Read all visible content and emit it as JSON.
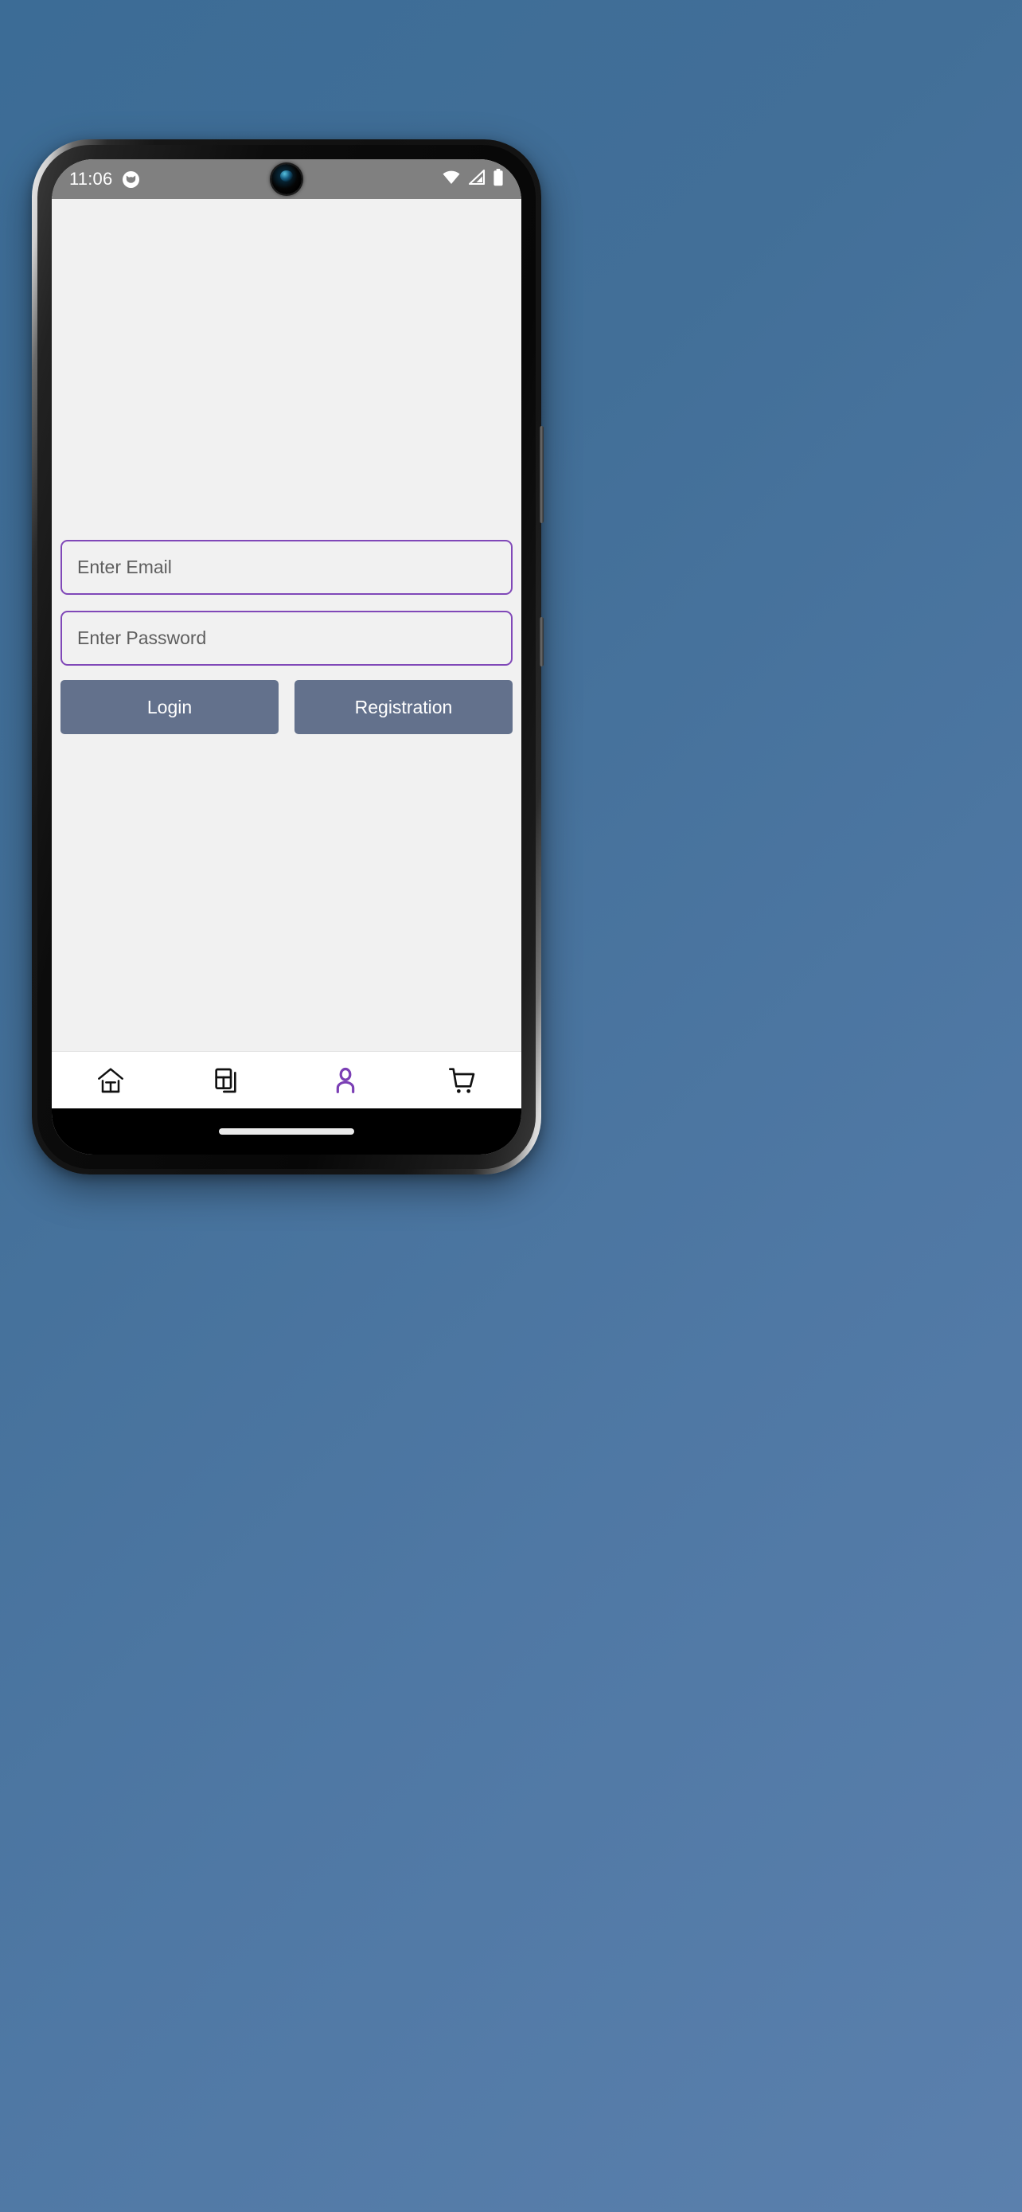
{
  "wallpaper": {
    "color_start": "#3c6c96",
    "color_end": "#5b80ad"
  },
  "device": {
    "frame_color": "#111111",
    "rim_color": "#d8d8d8"
  },
  "status_bar": {
    "background": "#808080",
    "time": "11:06",
    "notification_icon": "cat-face-icon",
    "icons": [
      "wifi-icon",
      "cellular-signal-icon",
      "battery-icon"
    ]
  },
  "app": {
    "background": "#f1f1f1",
    "accent_color": "#8048b8",
    "form": {
      "email": {
        "placeholder": "Enter Email",
        "value": "",
        "border_color": "#8048b8"
      },
      "password": {
        "placeholder": "Enter Password",
        "value": "",
        "border_color": "#8048b8"
      },
      "login_label": "Login",
      "registration_label": "Registration",
      "button_color": "#63718c",
      "button_text_color": "#ffffff"
    }
  },
  "bottom_nav": {
    "background": "#ffffff",
    "active_color": "#7b3fb5",
    "inactive_color": "#111111",
    "items": [
      {
        "name": "home",
        "icon": "home-icon",
        "active": false
      },
      {
        "name": "catalog",
        "icon": "grid-layout-icon",
        "active": false
      },
      {
        "name": "profile",
        "icon": "person-icon",
        "active": true
      },
      {
        "name": "cart",
        "icon": "shopping-cart-icon",
        "active": false
      }
    ]
  },
  "gesture_bar": {
    "background": "#000000",
    "pill_color": "#eaeaea"
  }
}
